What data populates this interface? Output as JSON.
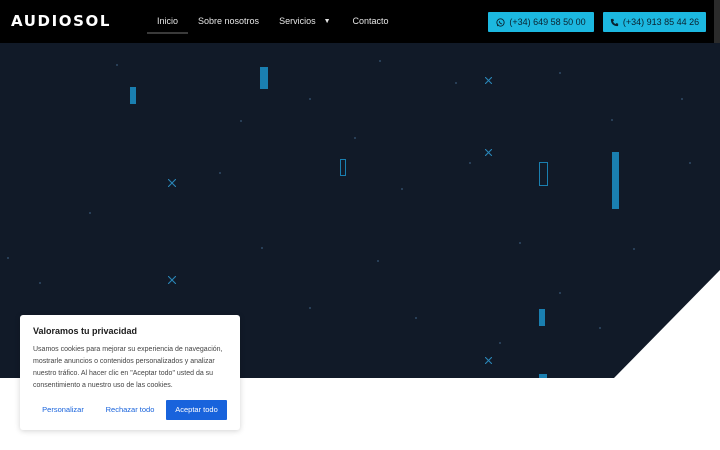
{
  "brand": {
    "logo_text": "AUDIOSOL"
  },
  "nav": {
    "items": [
      {
        "label": "Inicio",
        "active": true
      },
      {
        "label": "Sobre nosotros"
      },
      {
        "label": "Servicios",
        "has_dropdown": true
      },
      {
        "label": "Contacto"
      }
    ]
  },
  "contact": {
    "whatsapp_label": "(+34) 649 58 50 00",
    "phone_label": "(+34) 913 85 44 26",
    "button_color": "#1cb8e0"
  },
  "hero": {
    "background_color": "#111a28",
    "accent_color": "#1a7fb0"
  },
  "cookie": {
    "title": "Valoramos tu privacidad",
    "text": "Usamos cookies para mejorar su experiencia de navegación, mostrarle anuncios o contenidos personalizados y analizar nuestro tráfico. Al hacer clic en \"Aceptar todo\" usted da su consentimiento a nuestro uso de las cookies.",
    "customize_label": "Personalizar",
    "reject_label": "Rechazar todo",
    "accept_label": "Aceptar todo",
    "accent_color": "#1863dc"
  },
  "icons": {
    "whatsapp": "whatsapp-icon",
    "phone": "phone-icon",
    "dropdown": "chevron-down-icon"
  }
}
